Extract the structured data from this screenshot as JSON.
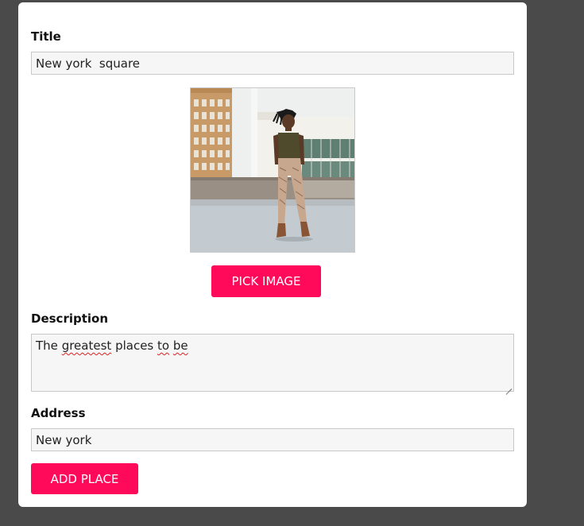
{
  "form": {
    "title_label": "Title",
    "title_value": "New york  square",
    "pick_image_label": "PICK IMAGE",
    "description_label": "Description",
    "description_words": [
      "The",
      "greatest",
      "places",
      "to",
      "be"
    ],
    "address_label": "Address",
    "address_value": "New york",
    "submit_label": "ADD PLACE"
  },
  "colors": {
    "page_background": "#4a4a4a",
    "card_background": "#ffffff",
    "accent": "#ff0a5a",
    "field_background": "#f6f6f6"
  }
}
